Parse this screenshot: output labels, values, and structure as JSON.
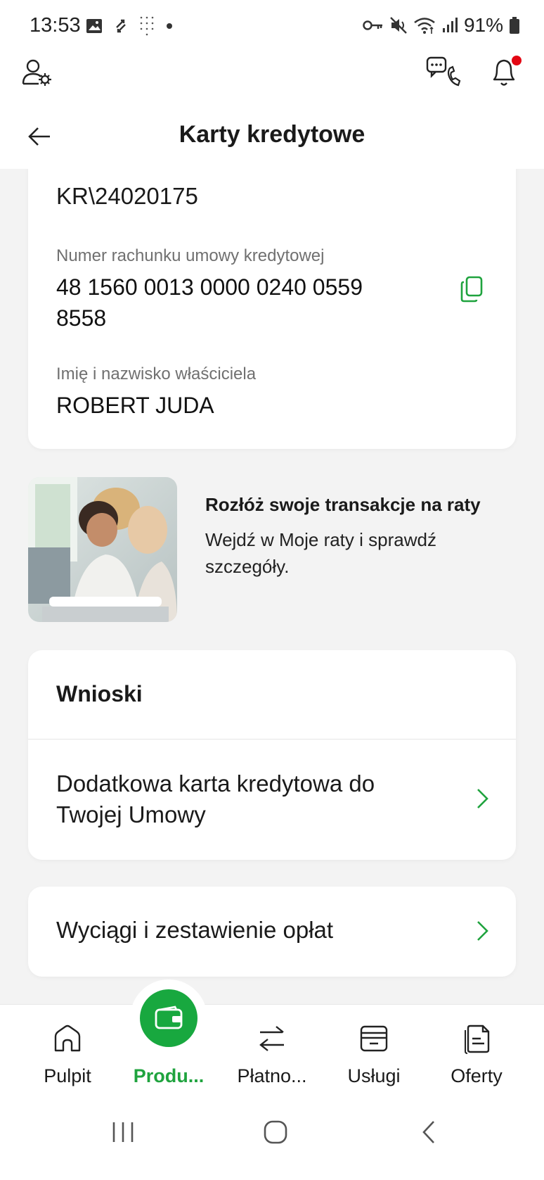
{
  "status_bar": {
    "time": "13:53",
    "battery_text": "91%",
    "left_icons": [
      "image-icon",
      "sync-icon",
      "dots-grid-icon",
      "dot-icon"
    ],
    "right_icons": [
      "key-icon",
      "mute-icon",
      "wifi-icon",
      "signal-icon",
      "battery-icon"
    ]
  },
  "header": {
    "title": "Karty kredytowe",
    "icons": [
      "user-settings-icon",
      "chat-phone-icon",
      "bell-icon",
      "back-arrow-icon"
    ]
  },
  "account_card": {
    "contract_number": "KR\\24020175",
    "account_label": "Numer rachunku umowy kredytowej",
    "account_number_line1": "48 1560 0013 0000 0240 0559",
    "account_number_line2": "8558",
    "owner_label": "Imię i nazwisko właściciela",
    "owner_name": "ROBERT JUDA"
  },
  "promo": {
    "title": "Rozłóż swoje transakcje na raty",
    "text": "Wejdź w Moje raty i sprawdź szczegóły."
  },
  "wnioski": {
    "title": "Wnioski",
    "item_line1": "Dodatkowa karta kredytowa do",
    "item_line2": "Twojej Umowy"
  },
  "wyciagi": {
    "label": "Wyciągi i zestawienie opłat"
  },
  "bottom_nav": {
    "items": [
      {
        "label": "Pulpit",
        "icon": "home-icon"
      },
      {
        "label": "Produ...",
        "icon": "wallet-icon",
        "active": true
      },
      {
        "label": "Płatno...",
        "icon": "transfer-arrows-icon"
      },
      {
        "label": "Usługi",
        "icon": "services-icon"
      },
      {
        "label": "Oferty",
        "icon": "documents-icon"
      }
    ]
  },
  "colors": {
    "accent": "#18a83f",
    "accent_text": "#1fa33e",
    "notification_dot": "#e30613",
    "background": "#f3f3f3"
  }
}
